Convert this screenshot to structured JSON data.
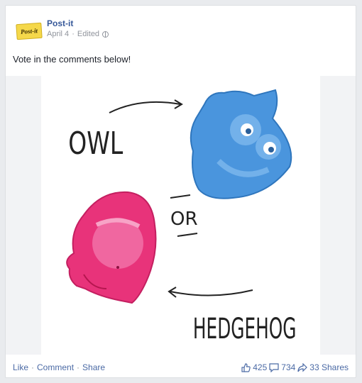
{
  "post": {
    "page_name": "Post-it",
    "logo_text": "Post-it",
    "date": "April 4",
    "separator": "·",
    "edited": "Edited",
    "text": "Vote in the comments below!"
  },
  "photo": {
    "label_owl": "OWL",
    "label_or": "OR",
    "label_hedgehog": "HEDGEHOG",
    "colors": {
      "owl": "#4a95dd",
      "hedgehog": "#e8337a",
      "background": "#ffffff"
    }
  },
  "actions": {
    "like": "Like",
    "comment": "Comment",
    "share": "Share",
    "separator": "·"
  },
  "stats": {
    "likes": "425",
    "comments": "734",
    "shares": "33 Shares"
  },
  "colors": {
    "link": "#365899",
    "meta": "#90949c",
    "text": "#1d2129"
  }
}
